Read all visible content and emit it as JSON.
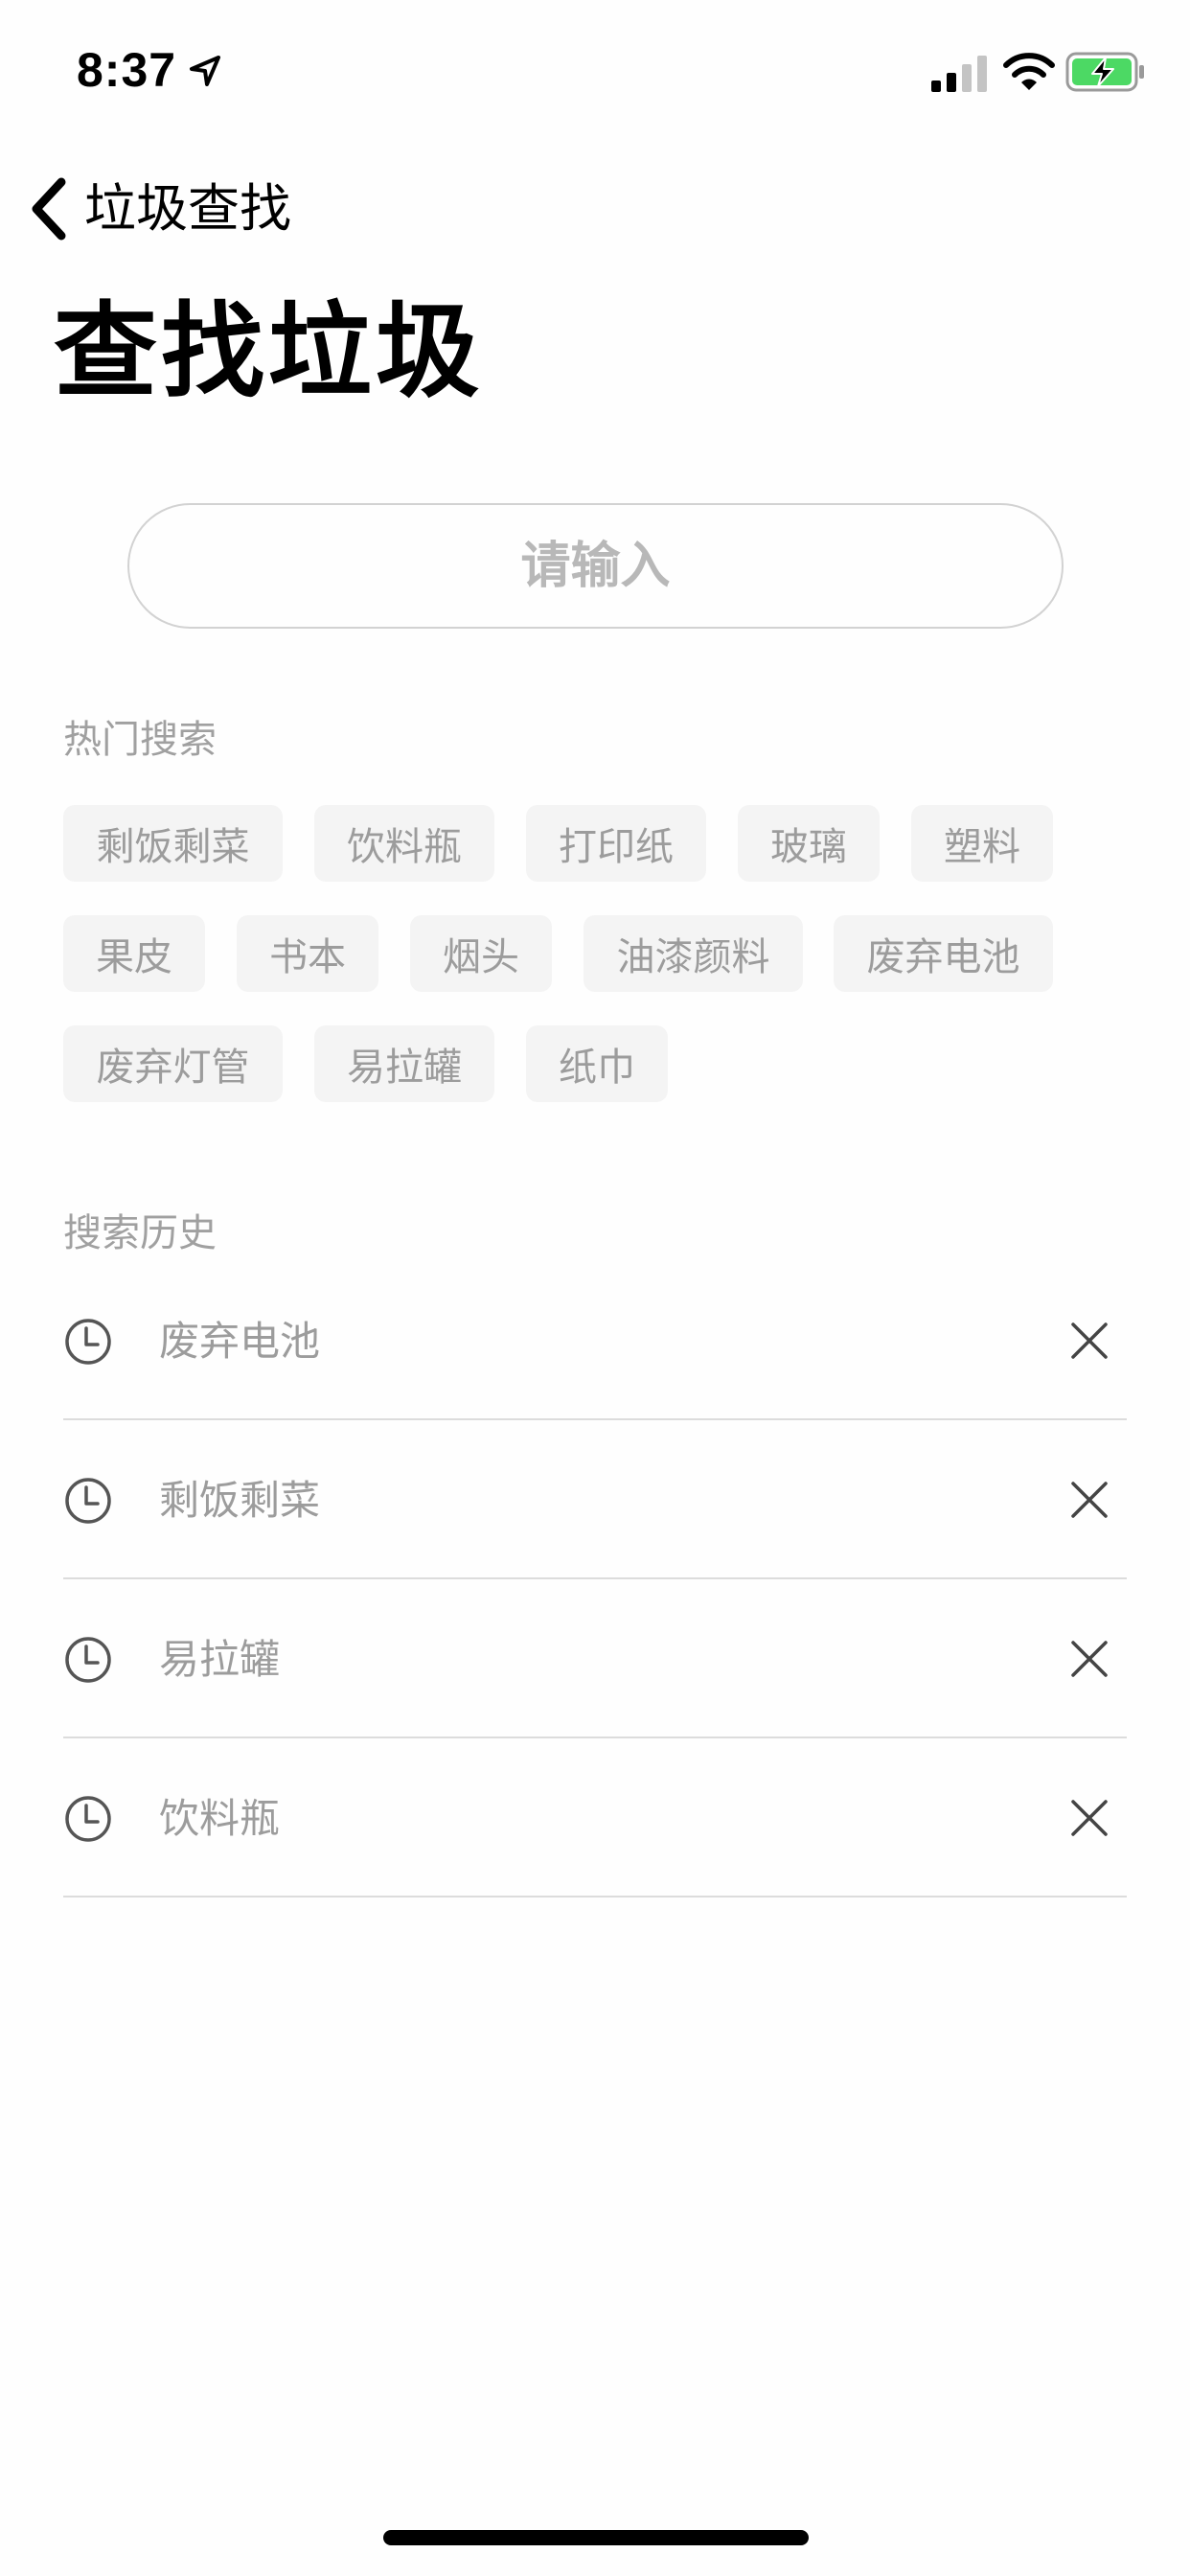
{
  "status_bar": {
    "time": "8:37",
    "icons": [
      "location-arrow-icon",
      "signal-icon",
      "wifi-icon",
      "battery-charging-icon"
    ],
    "battery_color": "#4cd964"
  },
  "nav": {
    "back_icon": "chevron-left-icon",
    "back_label": "垃圾查找"
  },
  "page_title": "查找垃圾",
  "search": {
    "placeholder": "请输入",
    "value": ""
  },
  "hot_search": {
    "label": "热门搜索",
    "tags": [
      "剩饭剩菜",
      "饮料瓶",
      "打印纸",
      "玻璃",
      "塑料",
      "果皮",
      "书本",
      "烟头",
      "油漆颜料",
      "废弃电池",
      "废弃灯管",
      "易拉罐",
      "纸巾"
    ]
  },
  "history": {
    "label": "搜索历史",
    "item_icon": "clock-icon",
    "remove_icon": "close-icon",
    "items": [
      "废弃电池",
      "剩饭剩菜",
      "易拉罐",
      "饮料瓶"
    ]
  },
  "colors": {
    "chip_background": "#f4f4f4",
    "muted_text": "#9c9c9c",
    "divider": "#dcdcdc"
  }
}
